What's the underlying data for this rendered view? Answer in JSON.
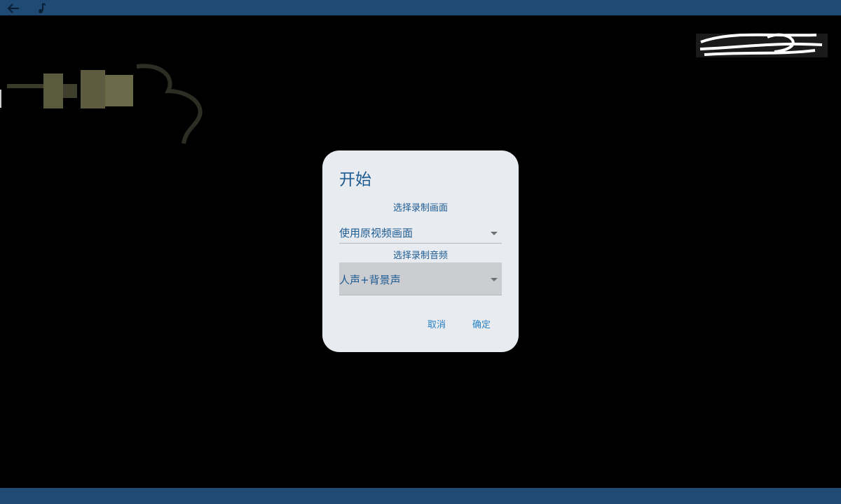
{
  "top_bar": {
    "back_icon": "arrow-left-icon",
    "music_icon": "music-note-icon"
  },
  "colors": {
    "bar": "#1f4a73",
    "dialog_bg": "#e8ebef",
    "title": "#1d5b93",
    "button": "#2a82c4"
  },
  "dialog": {
    "title": "开始",
    "video_section_label": "选择录制画面",
    "video_select_value": "使用原视频画面",
    "audio_section_label": "选择录制音频",
    "audio_select_value": "人声+背景声",
    "cancel_label": "取消",
    "ok_label": "确定"
  }
}
